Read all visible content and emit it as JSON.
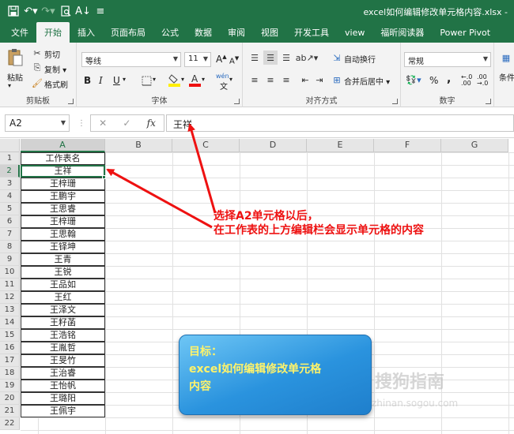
{
  "titlebar": {
    "title": "excel如何编辑修改单元格内容.xlsx -",
    "quick_access": [
      "save-icon",
      "undo-icon",
      "redo-icon",
      "print-preview-icon",
      "sort-icon",
      "customize-icon"
    ]
  },
  "tabs": [
    {
      "label": "文件",
      "active": false
    },
    {
      "label": "开始",
      "active": true
    },
    {
      "label": "插入",
      "active": false
    },
    {
      "label": "页面布局",
      "active": false
    },
    {
      "label": "公式",
      "active": false
    },
    {
      "label": "数据",
      "active": false
    },
    {
      "label": "审阅",
      "active": false
    },
    {
      "label": "视图",
      "active": false
    },
    {
      "label": "开发工具",
      "active": false
    },
    {
      "label": "view",
      "active": false
    },
    {
      "label": "福昕阅读器",
      "active": false
    },
    {
      "label": "Power Pivot",
      "active": false
    }
  ],
  "ribbon": {
    "clipboard": {
      "paste": "粘贴",
      "cut": "剪切",
      "copy": "复制 ▾",
      "format_painter": "格式刷",
      "label": "剪贴板"
    },
    "font": {
      "name": "等线",
      "size": "11",
      "bold": "B",
      "italic": "I",
      "underline": "U",
      "grow": "A",
      "shrink": "A",
      "phonetic": "wén",
      "label": "字体"
    },
    "alignment": {
      "wrap": "自动换行",
      "merge": "合并后居中 ▾",
      "label": "对齐方式"
    },
    "number": {
      "format": "常规",
      "percent": "%",
      "comma": ",",
      "label": "数字"
    },
    "styles": {
      "conditional": "条件"
    }
  },
  "formula_bar": {
    "name_box": "A2",
    "value": "王祥"
  },
  "columns": [
    "A",
    "B",
    "C",
    "D",
    "E",
    "F",
    "G"
  ],
  "rows": [
    "1",
    "2",
    "3",
    "4",
    "5",
    "6",
    "7",
    "8",
    "9",
    "10",
    "11",
    "12",
    "13",
    "14",
    "15",
    "16",
    "17",
    "18",
    "19",
    "20",
    "21",
    "22"
  ],
  "selected_cell": "A2",
  "column_a": [
    "工作表名",
    "王祥",
    "王梓珊",
    "王鹏宇",
    "王思睿",
    "王梓珊",
    "王思翰",
    "王铎坤",
    "王青",
    "王锐",
    "王品如",
    "王红",
    "王泽文",
    "王籽菡",
    "王浩铭",
    "王胤哲",
    "王旻竹",
    "王治睿",
    "王怡帆",
    "王璐阳",
    "王佩宇"
  ],
  "annotation": {
    "line1": "选择A2单元格以后，",
    "line2": "在工作表的上方编辑栏会显示单元格的内容"
  },
  "callout": {
    "line1": "目标：",
    "line2": "excel如何编辑修改单元格",
    "line3": "内容"
  },
  "watermark": {
    "text": "搜狗指南",
    "url": "zhinan.sogou.com"
  },
  "colors": {
    "excel_green": "#217346",
    "annotation_red": "#e11111",
    "callout_text": "#fff36a"
  }
}
